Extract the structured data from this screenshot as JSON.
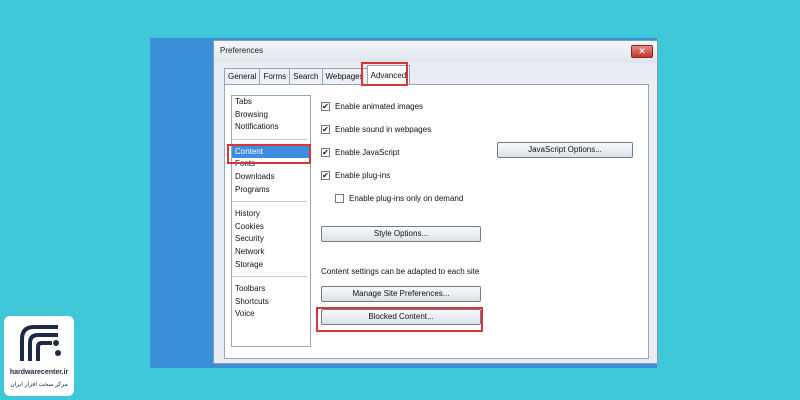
{
  "window": {
    "title": "Preferences",
    "close_glyph": "✕"
  },
  "tabs": [
    {
      "label": "General"
    },
    {
      "label": "Forms"
    },
    {
      "label": "Search"
    },
    {
      "label": "Webpages"
    },
    {
      "label": "Advanced",
      "active": true
    }
  ],
  "sidebar": {
    "groups": [
      [
        "Tabs",
        "Browsing",
        "Notifications"
      ],
      [
        "Content",
        "Fonts",
        "Downloads",
        "Programs"
      ],
      [
        "History",
        "Cookies",
        "Security",
        "Network",
        "Storage"
      ],
      [
        "Toolbars",
        "Shortcuts",
        "Voice"
      ]
    ],
    "selected": "Content"
  },
  "options": {
    "animated_images": {
      "label": "Enable animated images",
      "checked": true
    },
    "sound": {
      "label": "Enable sound in webpages",
      "checked": true
    },
    "javascript": {
      "label": "Enable JavaScript",
      "checked": true
    },
    "plugins": {
      "label": "Enable plug-ins",
      "checked": true
    },
    "plugins_on_demand": {
      "label": "Enable plug-ins only on demand",
      "checked": false
    }
  },
  "buttons": {
    "javascript_options": "JavaScript Options...",
    "style_options": "Style Options...",
    "manage_site_prefs": "Manage Site Preferences...",
    "blocked_content": "Blocked Content..."
  },
  "info_text": "Content settings can be adapted to each site",
  "check_glyph": "✔",
  "highlight_color": "#d9343a",
  "watermark": {
    "name": "hardwarecenter.ir",
    "subtitle": "مرکز سخت افزار ایران"
  }
}
